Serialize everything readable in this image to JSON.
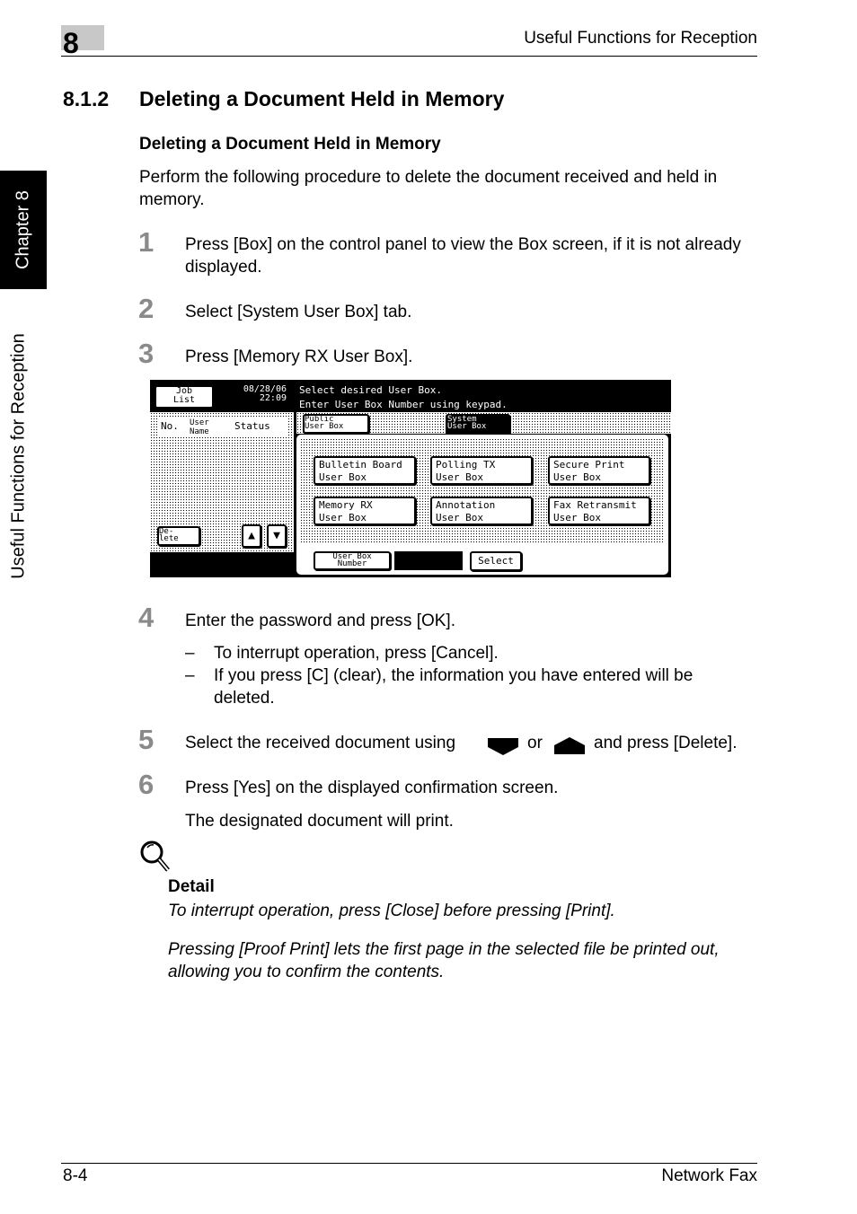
{
  "header": {
    "chapter_number": "8",
    "running_title": "Useful Functions for Reception"
  },
  "side": {
    "chapter_tab": "Chapter 8",
    "section_label": "Useful Functions for Reception"
  },
  "section": {
    "number": "8.1.2",
    "title": "Deleting a Document Held in Memory"
  },
  "subheading": "Deleting a Document Held in Memory",
  "intro": "Perform the following procedure to delete the document received and held in memory.",
  "steps": [
    {
      "n": "1",
      "text": "Press [Box] on the control panel to view the Box screen, if it is not already displayed."
    },
    {
      "n": "2",
      "text": "Select [System User Box] tab."
    },
    {
      "n": "3",
      "text": "Press [Memory RX User Box]."
    },
    {
      "n": "4",
      "text": "Enter the password and press [OK].",
      "bullets": [
        "To interrupt operation, press [Cancel].",
        "If you press [C] (clear), the information you have entered will be deleted."
      ]
    },
    {
      "n": "5",
      "text_a": "Select the received document using",
      "text_b": "or",
      "text_c": "and press [Delete]."
    },
    {
      "n": "6",
      "text": "Press [Yes] on the displayed confirmation screen.",
      "note": "The designated document will print."
    }
  ],
  "bullet_dash": "–",
  "screen": {
    "job_list": [
      "Job",
      "List"
    ],
    "date": "08/28/06",
    "time": "22:09",
    "message": [
      "Select desired User Box.",
      "Enter User Box Number using keypad."
    ],
    "columns": [
      "No.",
      "User Name",
      "Status"
    ],
    "tabs": [
      [
        "Public",
        "User Box"
      ],
      [
        "System",
        "User Box"
      ]
    ],
    "boxes": [
      [
        "Bulletin Board",
        "User Box"
      ],
      [
        "Polling TX",
        "User Box"
      ],
      [
        "Secure Print",
        "User Box"
      ],
      [
        "Memory RX",
        "User Box"
      ],
      [
        "Annotation",
        "User Box"
      ],
      [
        "Fax Retransmit",
        "User Box"
      ]
    ],
    "delete": [
      "De-",
      "lete"
    ],
    "user_box_number": [
      "User Box",
      "Number"
    ],
    "select": "Select"
  },
  "detail": {
    "title": "Detail",
    "paragraphs": [
      "To interrupt operation, press [Close] before pressing [Print].",
      "Pressing [Proof Print] lets the first page in the selected file be printed out, allowing you to confirm the contents."
    ]
  },
  "footer": {
    "page": "8-4",
    "title": "Network Fax"
  }
}
